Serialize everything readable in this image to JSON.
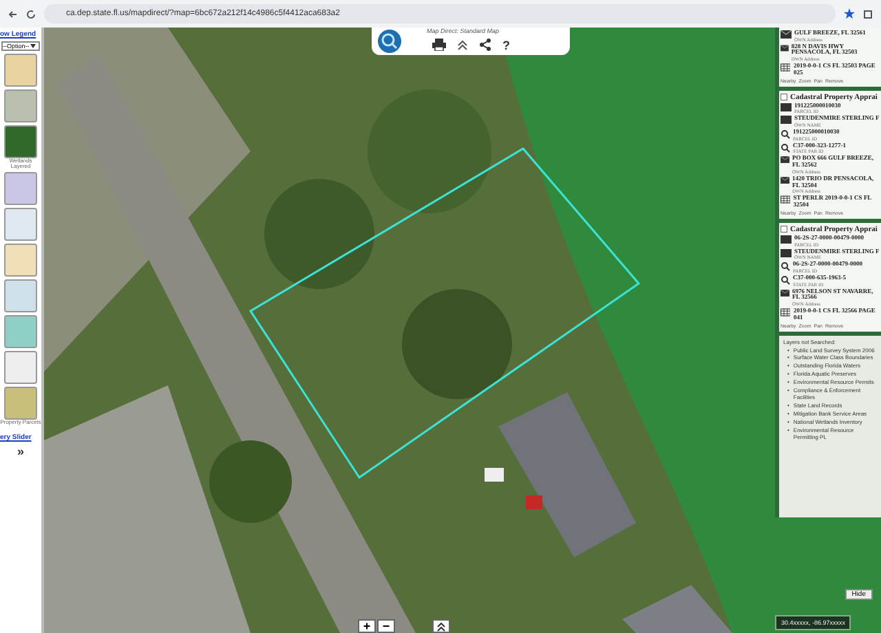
{
  "browser": {
    "url": "ca.dep.state.fl.us/mapdirect/?map=6bc672a212f14c4986c5f4412aca683a2"
  },
  "left_panel": {
    "legend_link": "ow Legend",
    "option_select": "--Option--",
    "thumbnails": [
      {
        "color": "#e9d3a0"
      },
      {
        "color": "#b9c0b0"
      },
      {
        "color": "#2f6a2a",
        "label": "Wetlands Layered"
      },
      {
        "color": "#c9c6e6"
      },
      {
        "color": "#dfe8ee"
      },
      {
        "color": "#f1dfb8"
      },
      {
        "color": "#cfe0ea"
      },
      {
        "color": "#8fcfc5"
      },
      {
        "color": "#eeeeee"
      },
      {
        "color": "#c8c07a",
        "label": "Property Parcels"
      }
    ],
    "slider_link": "ery Slider",
    "expand_button": "»"
  },
  "map_toolbar": {
    "title": "Map Direct: Standard Map",
    "help": "?"
  },
  "results": [
    {
      "rows": [
        {
          "kind": "mail",
          "value": "GULF BREEZE, FL 32561",
          "field": "OWN Address"
        },
        {
          "kind": "mail",
          "value": "828 N DAVIS HWY PENSACOLA, FL 32503",
          "field": "DWN Address"
        },
        {
          "kind": "table",
          "value": "2019-0-0-1 CS FL 32503 PAGE 025"
        }
      ],
      "actions": [
        "Nearby",
        "Zoom",
        "Pan",
        "Remove"
      ]
    },
    {
      "title": "Cadastral Property Apprai",
      "rows": [
        {
          "kind": "card",
          "value": "191225000010030",
          "field": "PARCEL ID"
        },
        {
          "kind": "card",
          "value": "STEUDENMIRE STERLING F",
          "field": "OWN NAME"
        },
        {
          "kind": "search",
          "value": "191225000010030",
          "field": "PARCEL ID"
        },
        {
          "kind": "search",
          "value": "C37-000-323-1277-1",
          "field": "STATE PAR ID"
        },
        {
          "kind": "mail",
          "value": "PO BOX 666 GULF BREEZE, FL 32562",
          "field": "OWN Address"
        },
        {
          "kind": "mail",
          "value": "1420 TRIO DR PENSACOLA, FL 32504",
          "field": "DWN Address"
        },
        {
          "kind": "table",
          "value": "ST PERLR 2019-0-0-1 CS FL 32504"
        }
      ],
      "actions": [
        "Nearby",
        "Zoom",
        "Pan",
        "Remove"
      ]
    },
    {
      "title": "Cadastral Property Apprai",
      "rows": [
        {
          "kind": "card",
          "value": "06-2S-27-0000-00479-0000",
          "field": "PARCEL ID"
        },
        {
          "kind": "card",
          "value": "STEUDENMIRE STERLING F",
          "field": "OWN NAME"
        },
        {
          "kind": "search",
          "value": "06-2S-27-0000-00479-0000",
          "field": "PARCEL ID"
        },
        {
          "kind": "search",
          "value": "C37-000-635-1963-5",
          "field": "STATE PAR ID"
        },
        {
          "kind": "mail",
          "value": "6976 NELSON ST NAVARRE, FL 32566",
          "field": "OWN Address"
        },
        {
          "kind": "table",
          "value": "2019-0-0-1 CS FL 32566 PAGE 041"
        }
      ],
      "actions": [
        "Nearby",
        "Zoom",
        "Pan",
        "Remove"
      ]
    }
  ],
  "not_searched": {
    "heading": "Layers not Searched:",
    "bullet": "•",
    "layers": [
      "Public Land Survey System 2006",
      "Surface Water Class Boundaries",
      "Outstanding Florida Waters",
      "Florida Aquatic Preserves",
      "Environmental Resource Permits",
      "Compliance & Enforcement Facilities",
      "State Land Records",
      "Mitigation Bank Service Areas",
      "National Wetlands Inventory",
      "Environmental Resource Permitting PL"
    ]
  },
  "hide_button": "Hide",
  "coordinates": "30.4xxxxx, -86.97xxxxx",
  "zoom_in": "+",
  "zoom_out": "−"
}
